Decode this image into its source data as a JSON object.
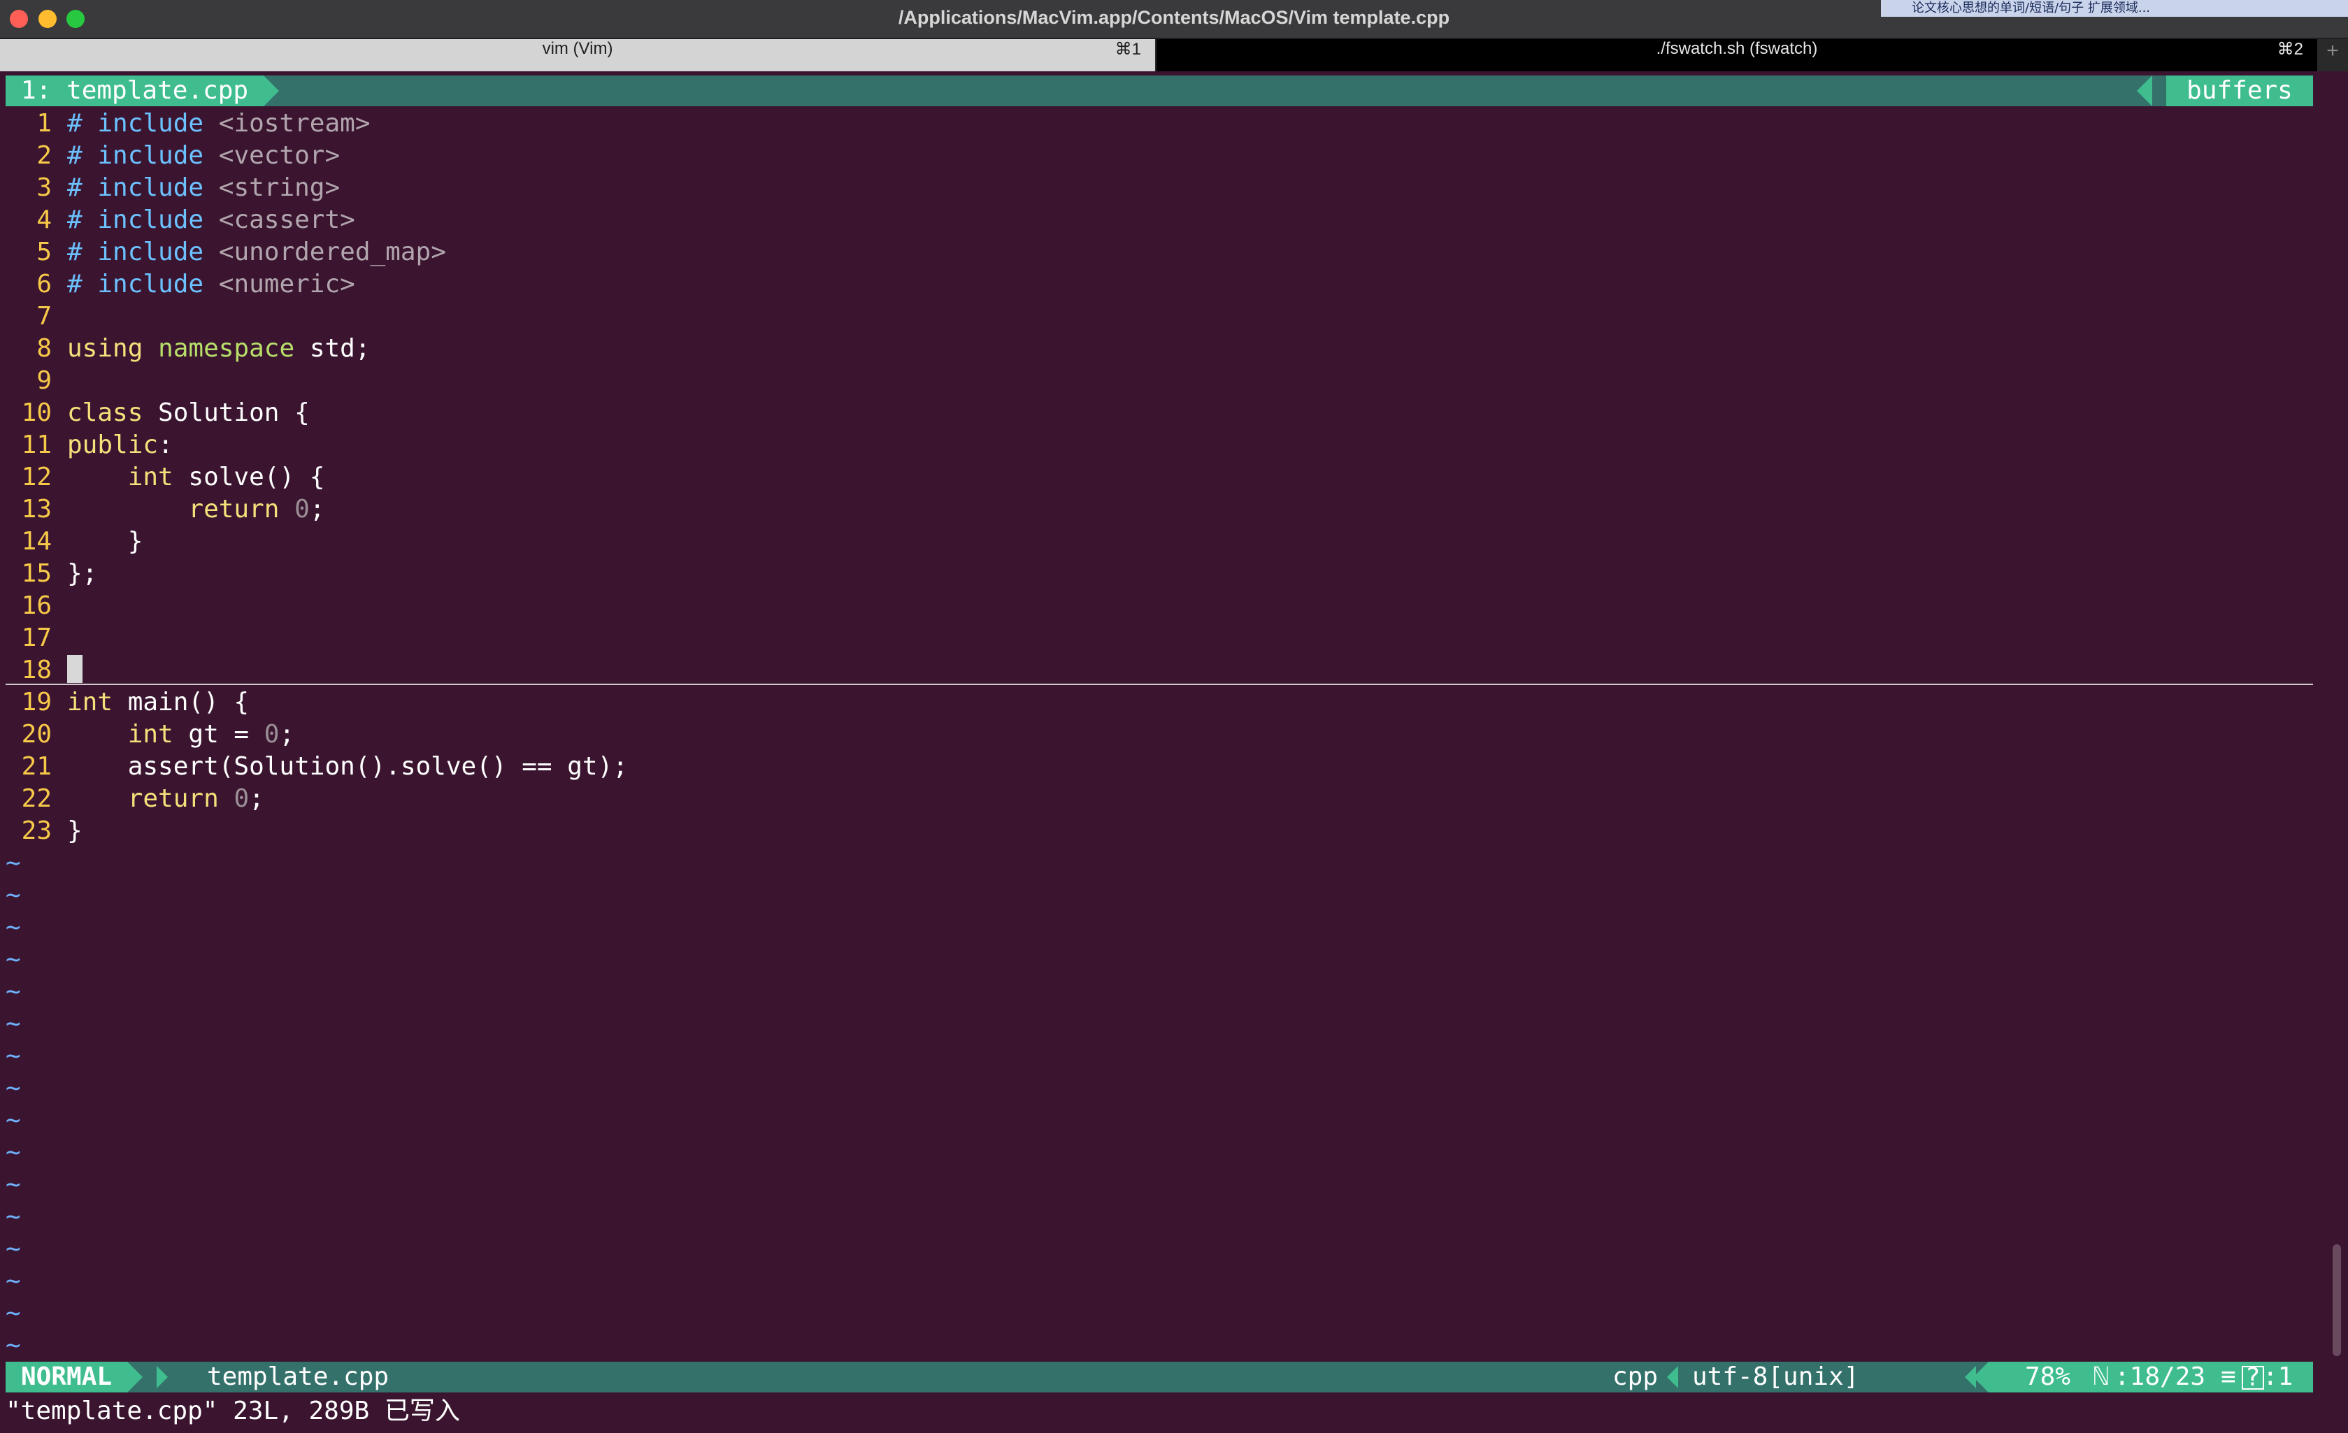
{
  "window": {
    "title": "/Applications/MacVim.app/Contents/MacOS/Vim template.cpp",
    "ime_hint": "论文核心思想的单词/短语/句子  扩展领域..."
  },
  "tabs": [
    {
      "label": "vim (Vim)",
      "shortcut": "⌘1"
    },
    {
      "label": "./fswatch.sh (fswatch)",
      "shortcut": "⌘2"
    }
  ],
  "tab_add_label": "+",
  "bufferline": {
    "current": "1: template.cpp",
    "right_label": "buffers"
  },
  "code_lines": [
    {
      "n": "1",
      "t": [
        {
          "c": "pre",
          "s": "# include"
        },
        {
          "c": "txt",
          "s": " "
        },
        {
          "c": "str",
          "s": "<iostream>"
        }
      ]
    },
    {
      "n": "2",
      "t": [
        {
          "c": "pre",
          "s": "# include"
        },
        {
          "c": "txt",
          "s": " "
        },
        {
          "c": "str",
          "s": "<vector>"
        }
      ]
    },
    {
      "n": "3",
      "t": [
        {
          "c": "pre",
          "s": "# include"
        },
        {
          "c": "txt",
          "s": " "
        },
        {
          "c": "str",
          "s": "<string>"
        }
      ]
    },
    {
      "n": "4",
      "t": [
        {
          "c": "pre",
          "s": "# include"
        },
        {
          "c": "txt",
          "s": " "
        },
        {
          "c": "str",
          "s": "<cassert>"
        }
      ]
    },
    {
      "n": "5",
      "t": [
        {
          "c": "pre",
          "s": "# include"
        },
        {
          "c": "txt",
          "s": " "
        },
        {
          "c": "str",
          "s": "<unordered_map>"
        }
      ]
    },
    {
      "n": "6",
      "t": [
        {
          "c": "pre",
          "s": "# include"
        },
        {
          "c": "txt",
          "s": " "
        },
        {
          "c": "str",
          "s": "<numeric>"
        }
      ]
    },
    {
      "n": "7",
      "t": []
    },
    {
      "n": "8",
      "t": [
        {
          "c": "kw",
          "s": "using"
        },
        {
          "c": "txt",
          "s": " "
        },
        {
          "c": "ns",
          "s": "namespace"
        },
        {
          "c": "txt",
          "s": " std;"
        }
      ]
    },
    {
      "n": "9",
      "t": []
    },
    {
      "n": "10",
      "t": [
        {
          "c": "kw",
          "s": "class"
        },
        {
          "c": "txt",
          "s": " Solution {"
        }
      ]
    },
    {
      "n": "11",
      "t": [
        {
          "c": "kw",
          "s": "public"
        },
        {
          "c": "txt",
          "s": ":"
        }
      ]
    },
    {
      "n": "12",
      "t": [
        {
          "c": "txt",
          "s": "    "
        },
        {
          "c": "kw",
          "s": "int"
        },
        {
          "c": "txt",
          "s": " solve() {"
        }
      ]
    },
    {
      "n": "13",
      "t": [
        {
          "c": "txt",
          "s": "        "
        },
        {
          "c": "kw",
          "s": "return"
        },
        {
          "c": "txt",
          "s": " "
        },
        {
          "c": "num",
          "s": "0"
        },
        {
          "c": "txt",
          "s": ";"
        }
      ]
    },
    {
      "n": "14",
      "t": [
        {
          "c": "txt",
          "s": "    }"
        }
      ]
    },
    {
      "n": "15",
      "t": [
        {
          "c": "txt",
          "s": "};"
        }
      ]
    },
    {
      "n": "16",
      "t": []
    },
    {
      "n": "17",
      "t": []
    },
    {
      "n": "18",
      "t": [
        {
          "c": "cursor",
          "s": ""
        }
      ]
    },
    {
      "n": "19",
      "t": [
        {
          "c": "kw",
          "s": "int"
        },
        {
          "c": "txt",
          "s": " main() {"
        }
      ]
    },
    {
      "n": "20",
      "t": [
        {
          "c": "txt",
          "s": "    "
        },
        {
          "c": "kw",
          "s": "int"
        },
        {
          "c": "txt",
          "s": " gt = "
        },
        {
          "c": "num",
          "s": "0"
        },
        {
          "c": "txt",
          "s": ";"
        }
      ]
    },
    {
      "n": "21",
      "t": [
        {
          "c": "txt",
          "s": "    assert(Solution().solve() == gt);"
        }
      ]
    },
    {
      "n": "22",
      "t": [
        {
          "c": "txt",
          "s": "    "
        },
        {
          "c": "kw",
          "s": "return"
        },
        {
          "c": "txt",
          "s": " "
        },
        {
          "c": "num",
          "s": "0"
        },
        {
          "c": "txt",
          "s": ";"
        }
      ]
    },
    {
      "n": "23",
      "t": [
        {
          "c": "txt",
          "s": "}"
        }
      ]
    }
  ],
  "tilde_char": "~",
  "tilde_count": 16,
  "statusline": {
    "mode": "NORMAL",
    "filename": "template.cpp",
    "filetype": "cpp",
    "encoding": "utf-8[unix]",
    "percent": "78%",
    "line_icon": "ℕ",
    "position": ":18/23",
    "col_icon": "≡",
    "help_icon": "?",
    "column": ":1"
  },
  "cmdline": "\"template.cpp\" 23L, 289B 已写入",
  "colors": {
    "background": "#3b1530",
    "accent_green": "#3fbd8e",
    "line_number": "#f7c948",
    "preproc": "#6cc2ff",
    "keyword": "#f5e07b",
    "namespace": "#b8df6a"
  }
}
